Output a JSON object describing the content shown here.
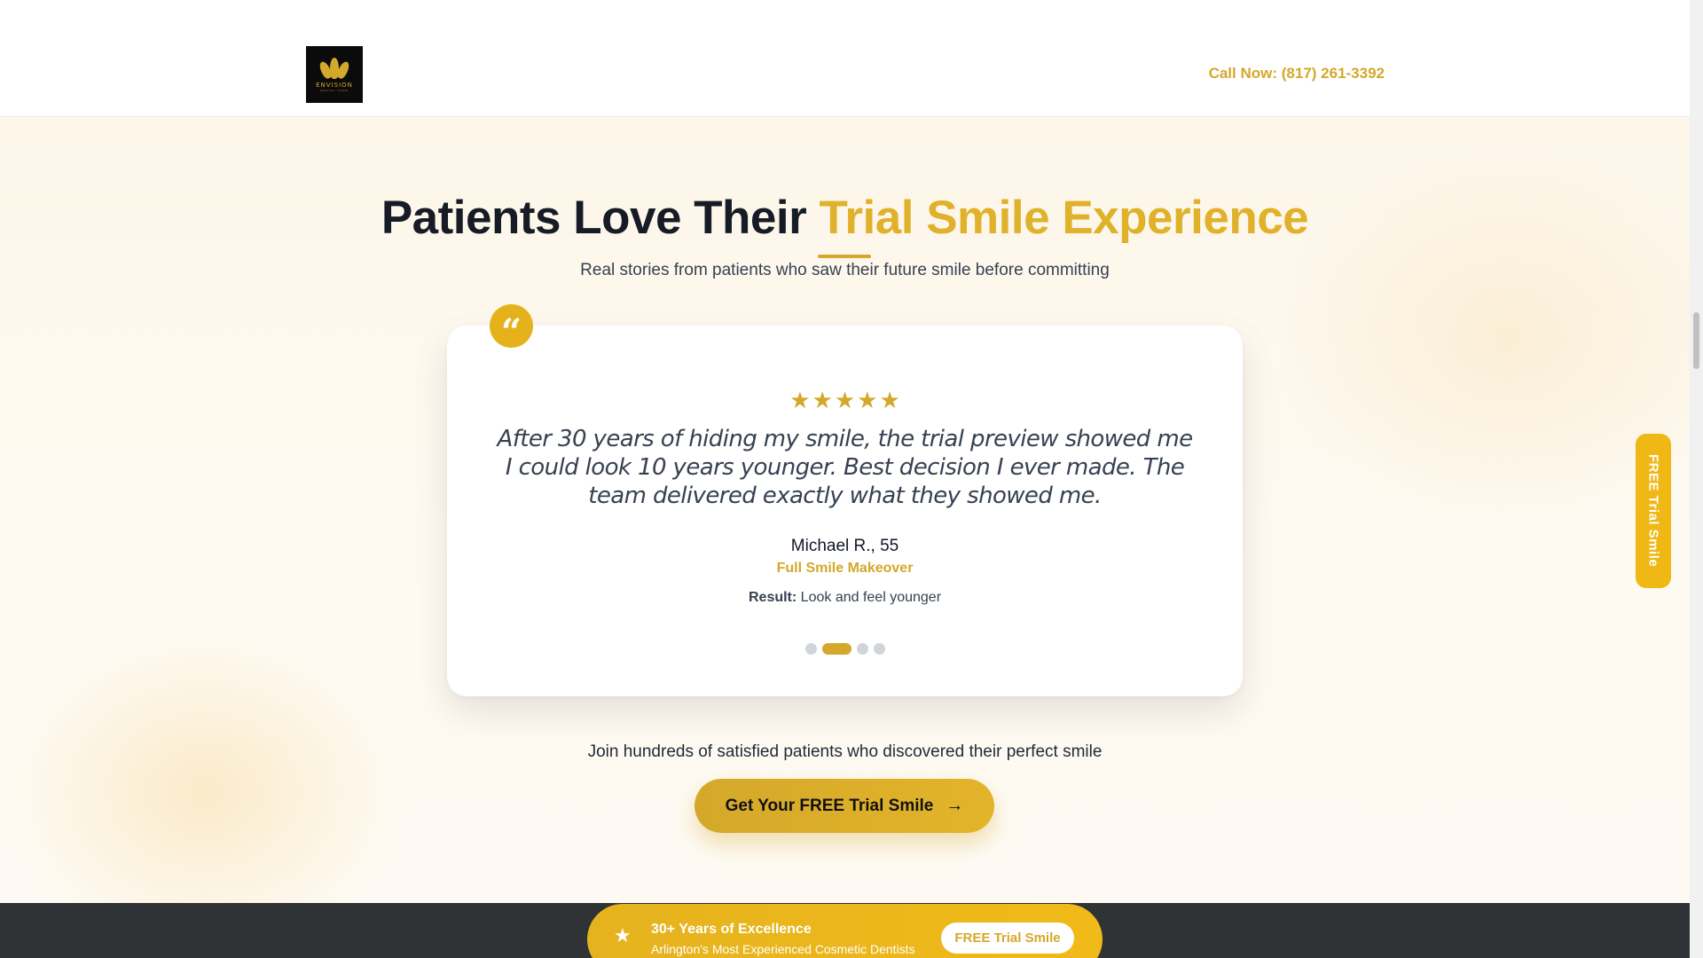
{
  "header": {
    "logo_text": "ENVISION",
    "logo_sub": "DENTAL CARE",
    "call_now": "Call Now: (817) 261-3392"
  },
  "testimonials": {
    "title_part1": "Patients Love Their ",
    "title_highlight": "Trial Smile Experience",
    "subtitle": "Real stories from patients who saw their future smile before committing",
    "quote_icon": "quote-icon",
    "rating": 5,
    "star_icon": "star-icon",
    "active": {
      "quote": "After 30 years of hiding my smile, the trial preview showed me I could look 10 years younger. Best decision I ever made. The team delivered exactly what they showed me.",
      "author": "Michael R., 55",
      "treatment": "Full Smile Makeover",
      "result_label": "Result:",
      "result_value": "Look and feel younger"
    },
    "slide_count": 4,
    "active_slide": 2
  },
  "cta": {
    "join_text": "Join hundreds of satisfied patients who discovered their perfect smile",
    "button_label": "Get Your FREE Trial Smile",
    "button_icon": "arrow-right-icon"
  },
  "side_tab": {
    "label": "FREE Trial Smile"
  },
  "promo_bar": {
    "icon": "star-icon",
    "title": "30+ Years of Excellence",
    "subtitle": "Arlington's Most Experienced Cosmetic Dentists",
    "button_label": "FREE Trial Smile"
  },
  "colors": {
    "accent": "#d4a82a",
    "dark_text": "#161b26",
    "bottom_bar": "#303336"
  }
}
